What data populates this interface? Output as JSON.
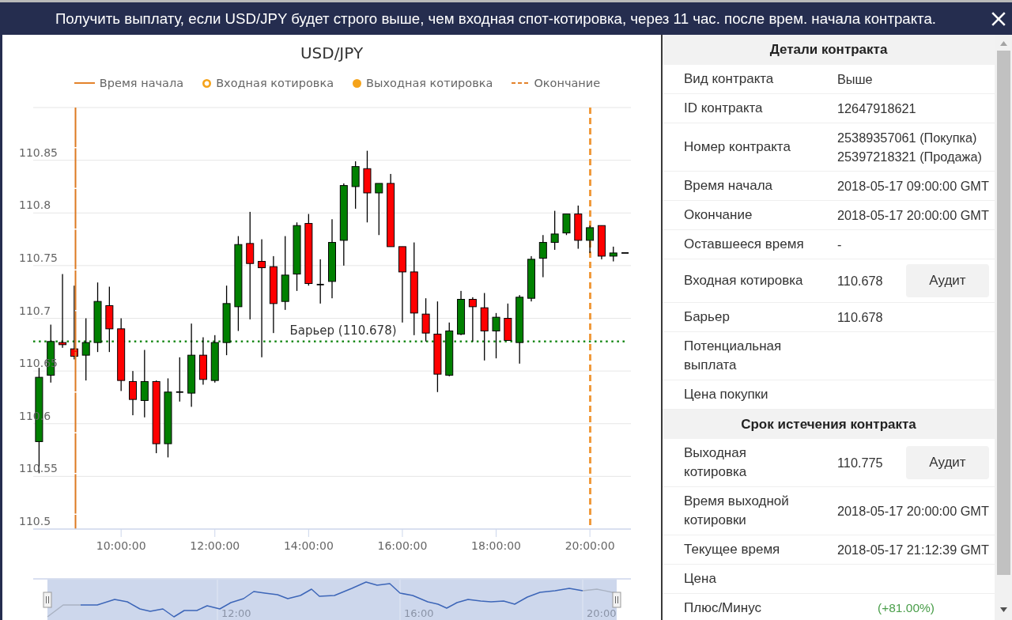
{
  "header": {
    "title": "Получить выплату, если USD/JPY будет строго выше, чем входная спот-котировка, через 11 час. после врем. начала контракта."
  },
  "chart": {
    "legend": [
      {
        "kind": "solid_line",
        "label": "Время начала"
      },
      {
        "kind": "ring",
        "label": "Входная котировка"
      },
      {
        "kind": "dot",
        "label": "Выходная котировка"
      },
      {
        "kind": "dashed_line",
        "label": "Окончание"
      }
    ],
    "chart_data": {
      "type": "candlestick",
      "title": "USD/JPY",
      "grid": true,
      "x": [
        8.25,
        8.5,
        8.75,
        9,
        9.25,
        9.5,
        9.75,
        10,
        10.25,
        10.5,
        10.75,
        11,
        11.25,
        11.5,
        11.75,
        12,
        12.25,
        12.5,
        12.75,
        13,
        13.25,
        13.5,
        13.75,
        14,
        14.25,
        14.5,
        14.75,
        15,
        15.25,
        15.5,
        15.75,
        16,
        16.25,
        16.5,
        16.75,
        17,
        17.25,
        17.5,
        17.75,
        18,
        18.25,
        18.5,
        18.75,
        19,
        19.25,
        19.5,
        19.75,
        20,
        20.25,
        20.5,
        20.75
      ],
      "ohlc": [
        [
          110.583,
          110.653,
          110.553,
          110.644
        ],
        [
          110.646,
          110.694,
          110.639,
          110.678
        ],
        [
          110.677,
          110.742,
          110.672,
          110.675
        ],
        [
          110.671,
          110.731,
          110.661,
          110.664
        ],
        [
          110.665,
          110.7,
          110.641,
          110.677
        ],
        [
          110.677,
          110.734,
          110.668,
          110.716
        ],
        [
          110.712,
          110.73,
          110.668,
          110.69
        ],
        [
          110.69,
          110.7,
          110.631,
          110.641
        ],
        [
          110.64,
          110.65,
          110.608,
          110.623
        ],
        [
          110.622,
          110.67,
          110.606,
          110.64
        ],
        [
          110.64,
          110.641,
          110.572,
          110.581
        ],
        [
          110.581,
          110.643,
          110.568,
          110.63
        ],
        [
          110.63,
          110.663,
          110.621,
          110.63
        ],
        [
          110.629,
          110.695,
          110.616,
          110.665
        ],
        [
          110.665,
          110.682,
          110.637,
          110.642
        ],
        [
          110.641,
          110.684,
          110.639,
          110.677
        ],
        [
          110.677,
          110.731,
          110.665,
          110.714
        ],
        [
          110.711,
          110.778,
          110.688,
          110.77
        ],
        [
          110.771,
          110.801,
          110.699,
          110.752
        ],
        [
          110.754,
          110.775,
          110.663,
          110.748
        ],
        [
          110.749,
          110.759,
          110.686,
          110.714
        ],
        [
          110.716,
          110.778,
          110.708,
          110.741
        ],
        [
          110.742,
          110.791,
          110.726,
          110.788
        ],
        [
          110.79,
          110.799,
          110.731,
          110.733
        ],
        [
          110.732,
          110.756,
          110.714,
          110.732
        ],
        [
          110.735,
          110.794,
          110.719,
          110.772
        ],
        [
          110.774,
          110.828,
          110.75,
          110.826
        ],
        [
          110.825,
          110.849,
          110.804,
          110.844
        ],
        [
          110.842,
          110.859,
          110.791,
          110.819
        ],
        [
          110.819,
          110.828,
          110.779,
          110.828
        ],
        [
          110.828,
          110.837,
          110.768,
          110.768
        ],
        [
          110.768,
          110.768,
          110.696,
          110.744
        ],
        [
          110.744,
          110.772,
          110.684,
          110.705
        ],
        [
          110.704,
          110.719,
          110.678,
          110.686
        ],
        [
          110.685,
          110.716,
          110.63,
          110.647
        ],
        [
          110.646,
          110.696,
          110.645,
          110.688
        ],
        [
          110.685,
          110.726,
          110.684,
          110.718
        ],
        [
          110.718,
          110.72,
          110.678,
          110.711
        ],
        [
          110.71,
          110.724,
          110.66,
          110.688
        ],
        [
          110.688,
          110.705,
          110.662,
          110.701
        ],
        [
          110.7,
          110.714,
          110.679,
          110.679
        ],
        [
          110.677,
          110.722,
          110.657,
          110.72
        ],
        [
          110.719,
          110.759,
          110.716,
          110.756
        ],
        [
          110.757,
          110.779,
          110.739,
          110.772
        ],
        [
          110.772,
          110.802,
          110.765,
          110.78
        ],
        [
          110.781,
          110.799,
          110.779,
          110.799
        ],
        [
          110.799,
          110.807,
          110.766,
          110.774
        ],
        [
          110.774,
          110.788,
          110.762,
          110.786
        ],
        [
          110.788,
          110.788,
          110.756,
          110.759
        ],
        [
          110.759,
          110.768,
          110.754,
          110.762
        ],
        [
          110.762,
          110.762,
          110.762,
          110.762
        ]
      ],
      "xlim": [
        8.125,
        20.875
      ],
      "ylim": [
        110.5,
        110.9
      ],
      "xticks": [
        {
          "value": 10,
          "label": "10:00:00"
        },
        {
          "value": 12,
          "label": "12:00:00"
        },
        {
          "value": 14,
          "label": "14:00:00"
        },
        {
          "value": 16,
          "label": "16:00:00"
        },
        {
          "value": 18,
          "label": "18:00:00"
        },
        {
          "value": 20,
          "label": "20:00:00"
        }
      ],
      "yticks": [
        110.5,
        110.55,
        110.6,
        110.65,
        110.7,
        110.75,
        110.8,
        110.85
      ],
      "ref_lines": [
        {
          "axis": "x",
          "value": 9,
          "color": "#dd7a22"
        },
        {
          "axis": "x",
          "value": 20,
          "color": "#f09a3c"
        },
        {
          "axis": "y",
          "value": 110.678,
          "color": "#1a8a1a",
          "label": "Барьер (110.678)"
        }
      ]
    }
  },
  "navigator": {
    "labels": [
      "12:00",
      "16:00",
      "20:00"
    ]
  },
  "details": {
    "sections": [
      {
        "title": "Детали контракта",
        "rows": [
          {
            "label": "Вид контракта",
            "values": [
              "Выше"
            ]
          },
          {
            "label": "ID контракта",
            "values": [
              "12647918621"
            ]
          },
          {
            "label": "Номер контракта",
            "values": [
              "25389357061 (Покупка)",
              "25397218321 (Продажа)"
            ]
          },
          {
            "label": "Время начала",
            "values": [
              "2018-05-17 09:00:00 GMT"
            ]
          },
          {
            "label": "Окончание",
            "values": [
              "2018-05-17 20:00:00 GMT"
            ]
          },
          {
            "label": "Оставшееся время",
            "values": [
              "-"
            ]
          },
          {
            "label": "Входная котировка",
            "values": [
              "110.678"
            ],
            "button": "Аудит"
          },
          {
            "label": "Барьер",
            "values": [
              "110.678"
            ]
          },
          {
            "label": "Потенциальная выплата"
          },
          {
            "label": "Цена покупки"
          }
        ]
      },
      {
        "title": "Срок истечения контракта",
        "rows": [
          {
            "label": "Выходная котировка",
            "values": [
              "110.775"
            ],
            "button": "Аудит"
          },
          {
            "label": "Время выходной котировки",
            "values": [
              "2018-05-17 20:00:00 GMT"
            ]
          },
          {
            "label": "Текущее время",
            "values": [
              "2018-05-17 21:12:39 GMT"
            ]
          },
          {
            "label": "Цена"
          },
          {
            "label": "Плюс/Минус",
            "change": {
              "text": "(+81.00%)",
              "positive": true
            }
          }
        ]
      }
    ]
  }
}
